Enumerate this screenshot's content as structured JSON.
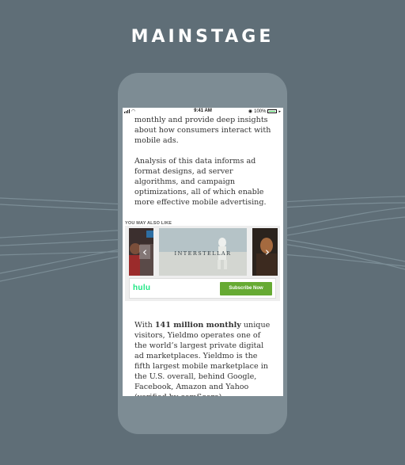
{
  "brand": {
    "title": "MAINSTAGE"
  },
  "status_bar": {
    "time": "9:41 AM",
    "battery": "100%",
    "battery_level": 1.0
  },
  "article": {
    "paragraph_top": "monthly and provide deep insights about how consumers interact with mobile ads.",
    "paragraph_mid": "Analysis of this data informs ad format designs, ad server algorithms, and campaign optimizations, all of which enable more effective mobile advertising.",
    "paragraph_bottom_prefix": "With ",
    "paragraph_bottom_bold": "141 million monthly",
    "paragraph_bottom_suffix": " unique visitors, Yieldmo operates one of the world’s largest private digital ad marketplaces. Yieldmo is the fifth largest mobile marketplace in the U.S. overall, behind Google, Facebook, Amazon and Yahoo (verified by comScore)."
  },
  "ad": {
    "label": "YOU MAY ALSO LIKE",
    "poster_center_title": "INTERSTELLAR",
    "prev_icon": "chevron-left-icon",
    "next_icon": "chevron-right-icon",
    "advertiser": "hulu",
    "cta": "Subscribe Now",
    "colors": {
      "hulu_green": "#1ce783",
      "cta_green": "#66aa33"
    }
  },
  "colors": {
    "background": "#5f6e77",
    "phone": "#7d8c94"
  }
}
